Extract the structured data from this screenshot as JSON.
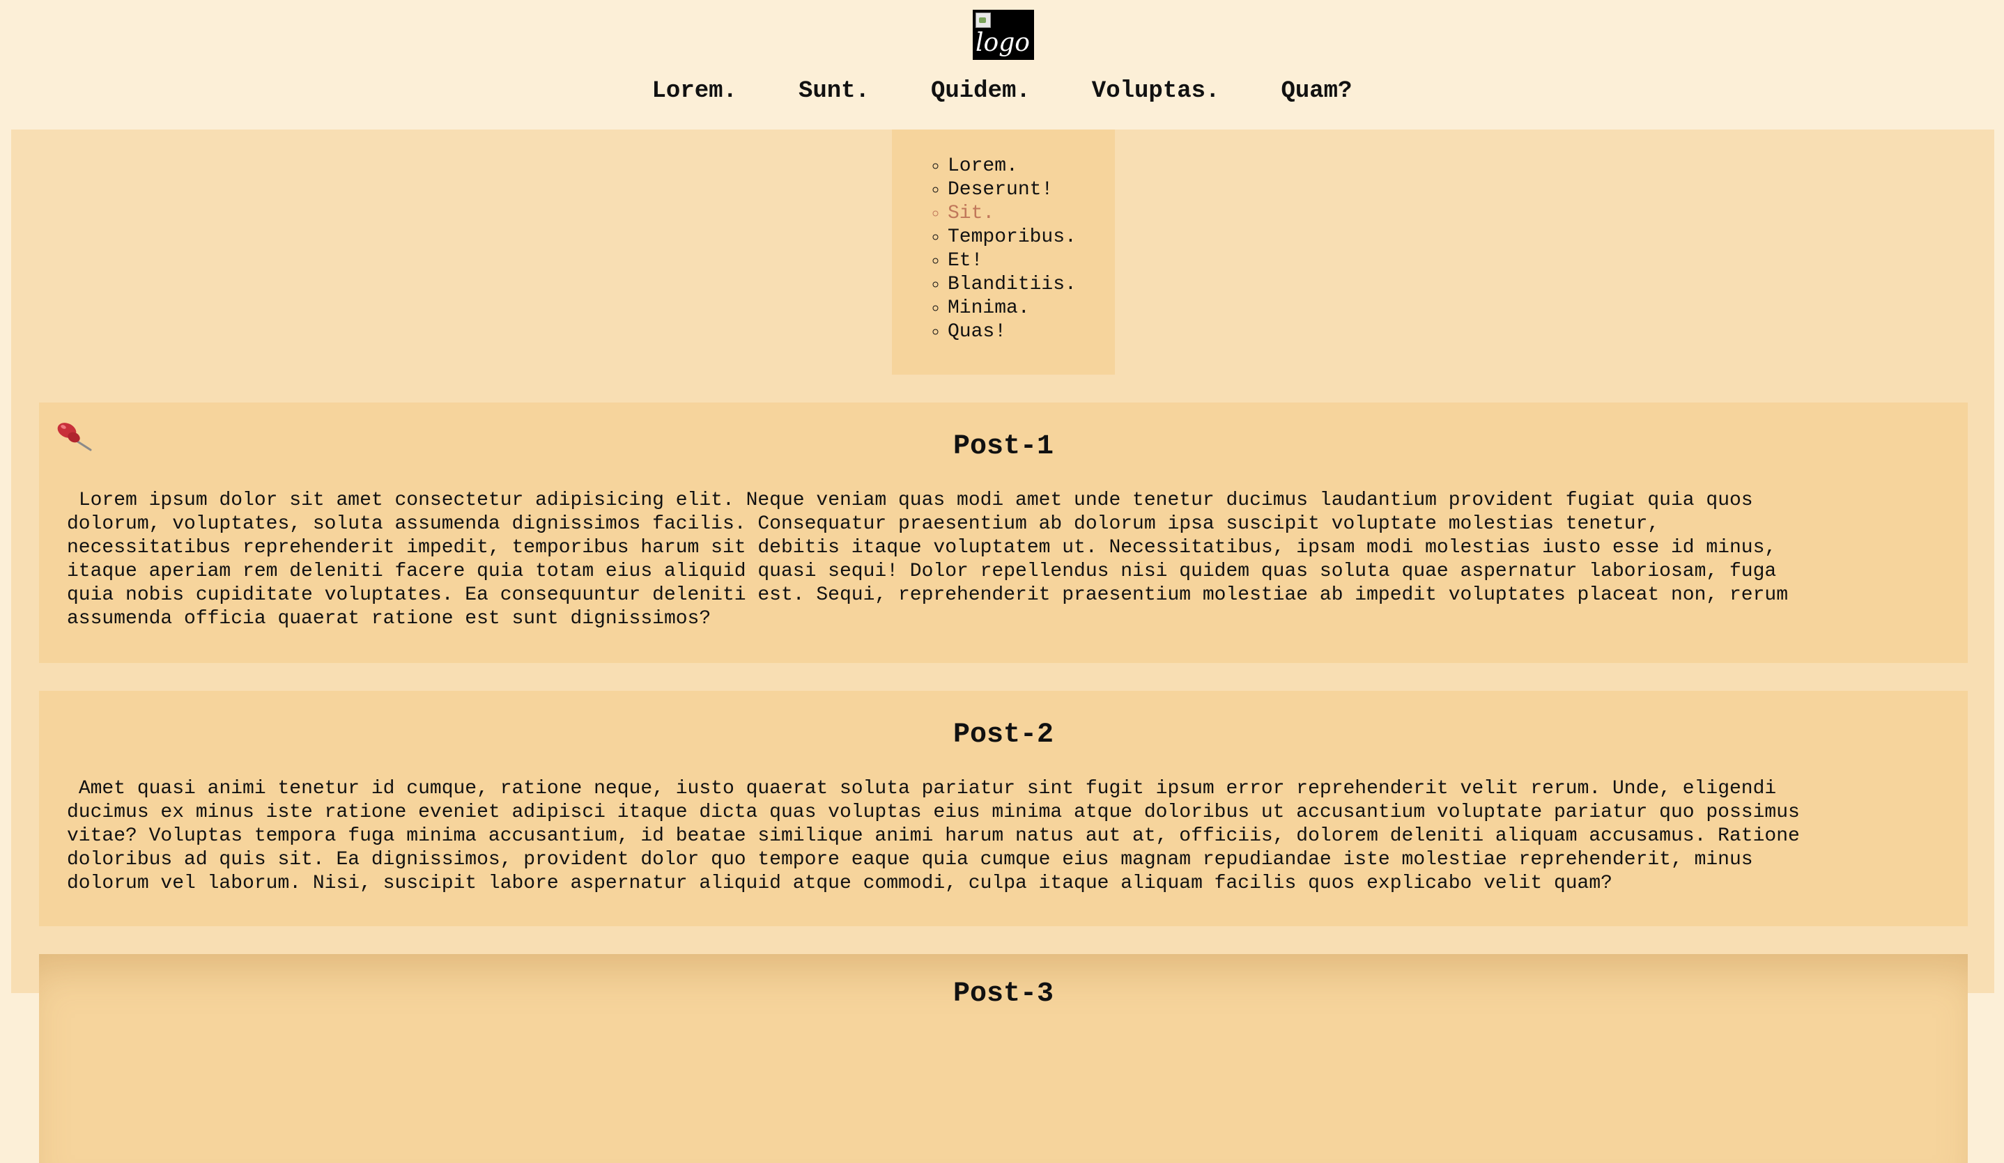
{
  "header": {
    "logo_alt": "logo",
    "nav": [
      "Lorem.",
      "Sunt.",
      "Quidem.",
      "Voluptas.",
      "Quam?"
    ]
  },
  "submenu": {
    "items": [
      "Lorem.",
      "Deserunt!",
      "Sit.",
      "Temporibus.",
      "Et!",
      "Blanditiis.",
      "Minima.",
      "Quas!"
    ],
    "active": "Sit."
  },
  "posts": [
    {
      "title": "Post-1",
      "pinned": true,
      "body": " Lorem ipsum dolor sit amet consectetur adipisicing elit. Neque veniam quas modi amet unde tenetur ducimus laudantium provident fugiat quia quos\ndolorum, voluptates, soluta assumenda dignissimos facilis. Consequatur praesentium ab dolorum ipsa suscipit voluptate molestias tenetur,\nnecessitatibus reprehenderit impedit, temporibus harum sit debitis itaque voluptatem ut. Necessitatibus, ipsam modi molestias iusto esse id minus,\nitaque aperiam rem deleniti facere quia totam eius aliquid quasi sequi! Dolor repellendus nisi quidem quas soluta quae aspernatur laboriosam, fuga\nquia nobis cupiditate voluptates. Ea consequuntur deleniti est. Sequi, reprehenderit praesentium molestiae ab impedit voluptates placeat non, rerum\nassumenda officia quaerat ratione est sunt dignissimos?"
    },
    {
      "title": "Post-2",
      "pinned": false,
      "body": " Amet quasi animi tenetur id cumque, ratione neque, iusto quaerat soluta pariatur sint fugit ipsum error reprehenderit velit rerum. Unde, eligendi\nducimus ex minus iste ratione eveniet adipisci itaque dicta quas voluptas eius minima atque doloribus ut accusantium voluptate pariatur quo possimus\nvitae? Voluptas tempora fuga minima accusantium, id beatae similique animi harum natus aut at, officiis, dolorem deleniti aliquam accusamus. Ratione\ndoloribus ad quis sit. Ea dignissimos, provident dolor quo tempore eaque quia cumque eius magnam repudiandae iste molestiae reprehenderit, minus\ndolorum vel laborum. Nisi, suscipit labore aspernatur aliquid atque commodi, culpa itaque aliquam facilis quos explicabo velit quam?"
    },
    {
      "title": "Post-3",
      "pinned": false,
      "body": ""
    }
  ]
}
